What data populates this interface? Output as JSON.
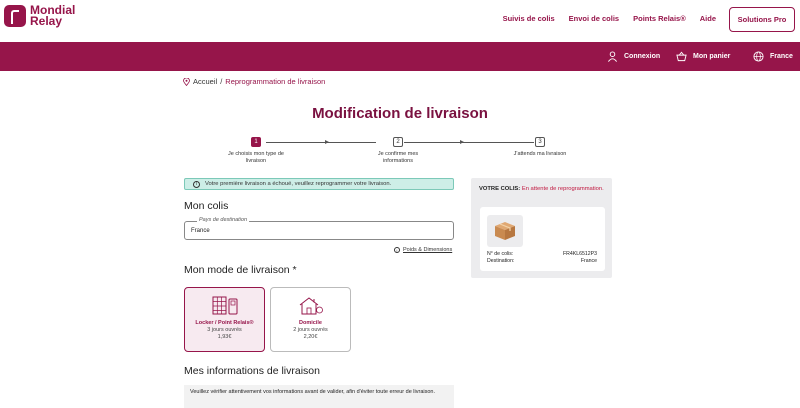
{
  "header": {
    "logo_line1": "Mondial",
    "logo_line2": "Relay",
    "nav": [
      "Suivis de colis",
      "Envoi de colis",
      "Points Relais®",
      "Aide"
    ],
    "pro_button": "Solutions Pro"
  },
  "topbar": {
    "login": "Connexion",
    "cart": "Mon panier",
    "country": "France"
  },
  "breadcrumb": {
    "home": "Accueil",
    "separator": "/",
    "current": "Reprogrammation de livraison"
  },
  "page_title": "Modification de livraison",
  "stepper": {
    "steps": [
      {
        "number": "1",
        "label": "Je choisis mon type de livraison"
      },
      {
        "number": "2",
        "label": "Je confirme mes informations"
      },
      {
        "number": "3",
        "label": "J'attends ma livraison"
      }
    ]
  },
  "alert": {
    "icon": "info-icon",
    "text": "Votre première livraison a échoué, veuillez reprogrammer votre livraison."
  },
  "mon_colis": {
    "heading": "Mon colis",
    "destination_label": "Pays de destination",
    "destination_value": "France",
    "poids_link": "Poids & Dimensions"
  },
  "mode": {
    "heading": "Mon mode de livraison *",
    "options": [
      {
        "name": "Locker / Point Relais®",
        "delay": "3 jours ouvrés",
        "price": "1,93€"
      },
      {
        "name": "Domicile",
        "delay": "2 jours ouvrés",
        "price": "2,20€"
      }
    ]
  },
  "infos": {
    "heading": "Mes informations de livraison",
    "notice": "Veuillez vérifier attentivement vos informations avant de valider, afin d'éviter toute erreur de livraison."
  },
  "colis_panel": {
    "label": "VOTRE COLIS:",
    "status": "En attente de reprogrammation.",
    "rows": [
      {
        "key": "N° de colis:",
        "value": "FR4KL6512P3"
      },
      {
        "key": "Destination:",
        "value": "France"
      }
    ]
  },
  "colors": {
    "brand": "#96154a",
    "alert_bg": "#cdeee7"
  }
}
